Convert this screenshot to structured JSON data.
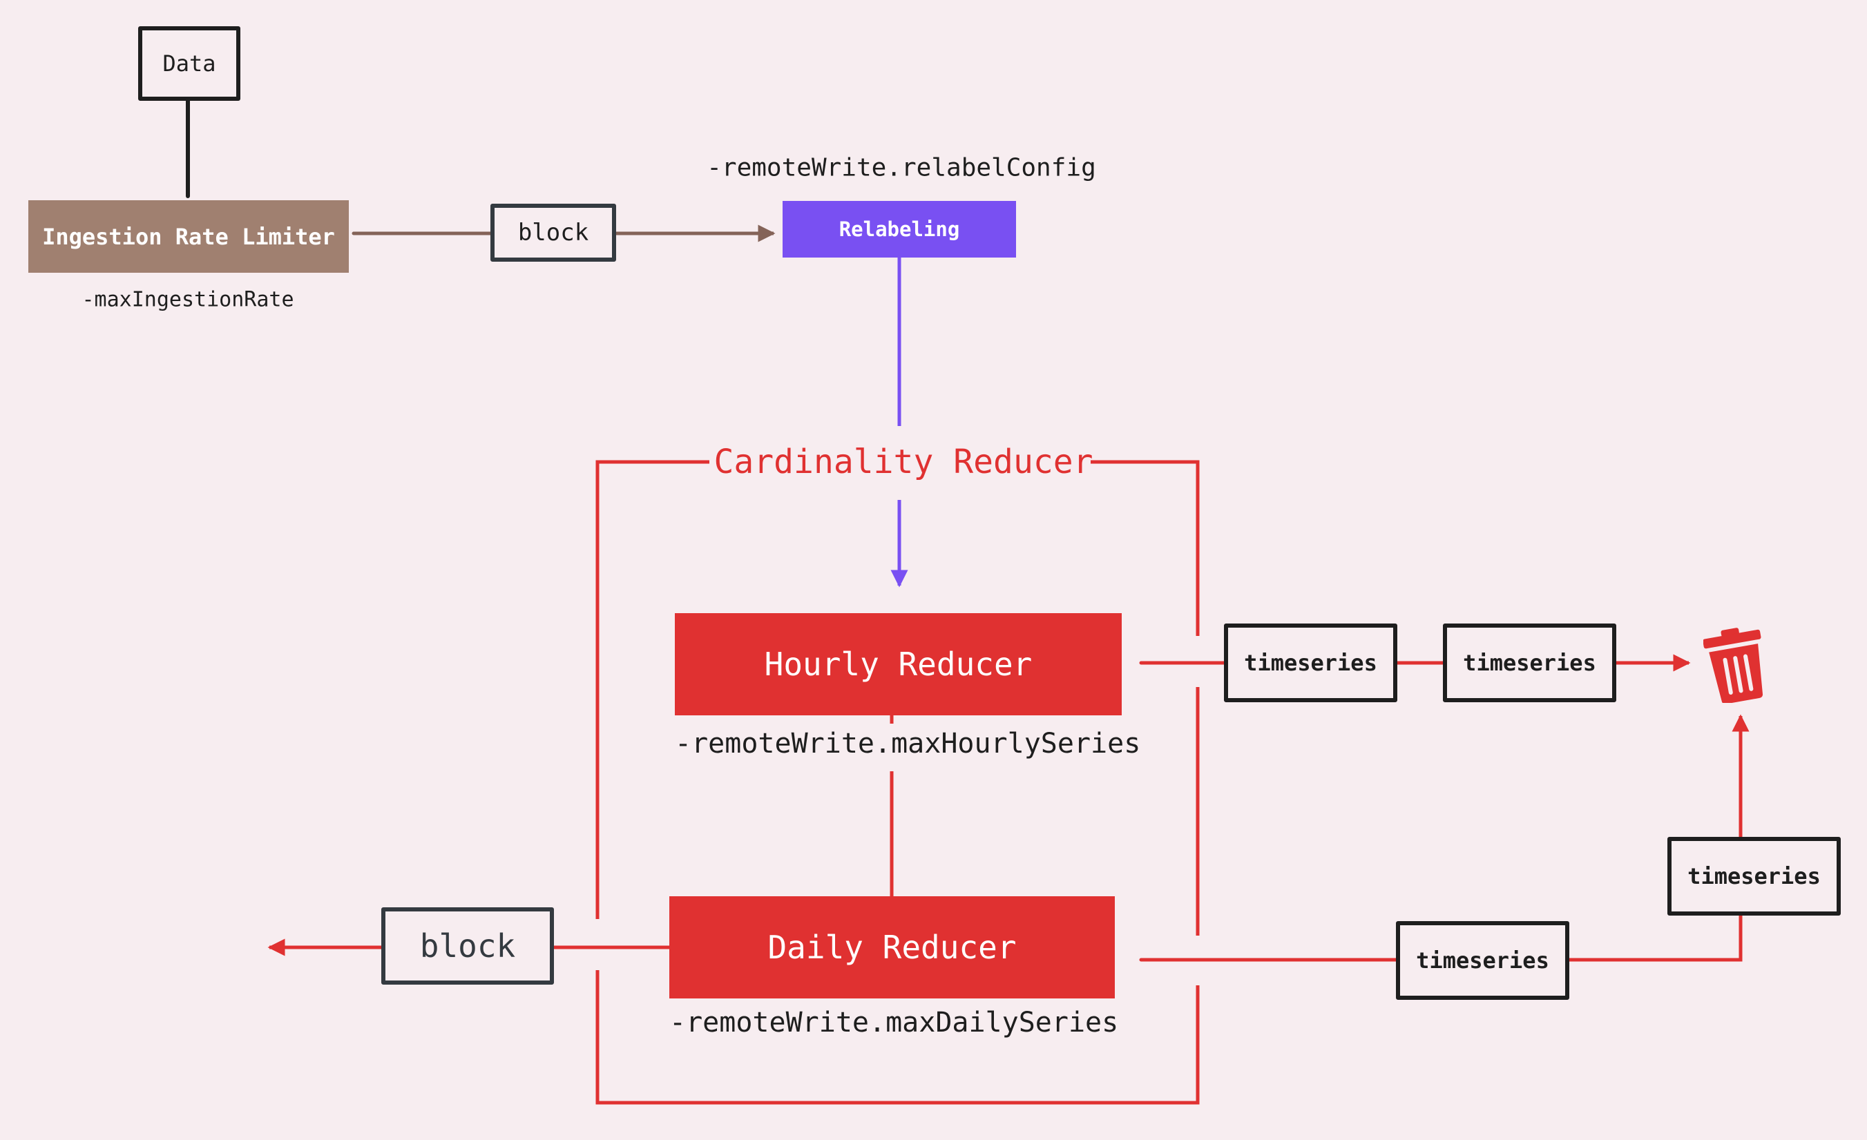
{
  "diagram": {
    "title": "Cardinality Reducer",
    "colors": {
      "background": "#f7edf0",
      "ingestion": "#a08070",
      "relabeling": "#7950f2",
      "reducer": "#e03131",
      "outline": "#1e1e1e",
      "brown_arrow": "#846358"
    },
    "nodes": {
      "data": "Data",
      "ingestion_rate_limiter": "Ingestion Rate Limiter",
      "block_top": "block",
      "relabeling": "Relabeling",
      "hourly_reducer": "Hourly Reducer",
      "daily_reducer": "Daily Reducer",
      "block_bottom": "block",
      "timeseries_1": "timeseries",
      "timeseries_2": "timeseries",
      "timeseries_3": "timeseries",
      "timeseries_4": "timeseries"
    },
    "labels": {
      "ingestion_flag": "-maxIngestionRate",
      "relabel_flag": "-remoteWrite.relabelConfig",
      "hourly_flag": "-remoteWrite.maxHourlySeries",
      "daily_flag": "-remoteWrite.maxDailySeries",
      "group_title": "Cardinality Reducer"
    },
    "icons": {
      "discard": "trash-icon"
    },
    "edges": [
      {
        "from": "data",
        "to": "ingestion_rate_limiter",
        "style": "line"
      },
      {
        "from": "ingestion_rate_limiter",
        "to": "block_top",
        "style": "line"
      },
      {
        "from": "block_top",
        "to": "relabeling",
        "style": "arrow"
      },
      {
        "from": "relabeling",
        "to": "hourly_reducer",
        "style": "arrow"
      },
      {
        "from": "hourly_reducer",
        "to": "daily_reducer",
        "style": "line"
      },
      {
        "from": "hourly_reducer",
        "to": "timeseries_1",
        "style": "line"
      },
      {
        "from": "timeseries_1",
        "to": "timeseries_2",
        "style": "line"
      },
      {
        "from": "timeseries_2",
        "to": "trash",
        "style": "arrow"
      },
      {
        "from": "daily_reducer",
        "to": "timeseries_4",
        "style": "line"
      },
      {
        "from": "timeseries_4",
        "to": "timeseries_3",
        "style": "line"
      },
      {
        "from": "timeseries_3",
        "to": "trash",
        "style": "arrow"
      },
      {
        "from": "daily_reducer",
        "to": "block_bottom",
        "style": "line"
      },
      {
        "from": "block_bottom",
        "to": "outside",
        "style": "arrow"
      }
    ]
  }
}
